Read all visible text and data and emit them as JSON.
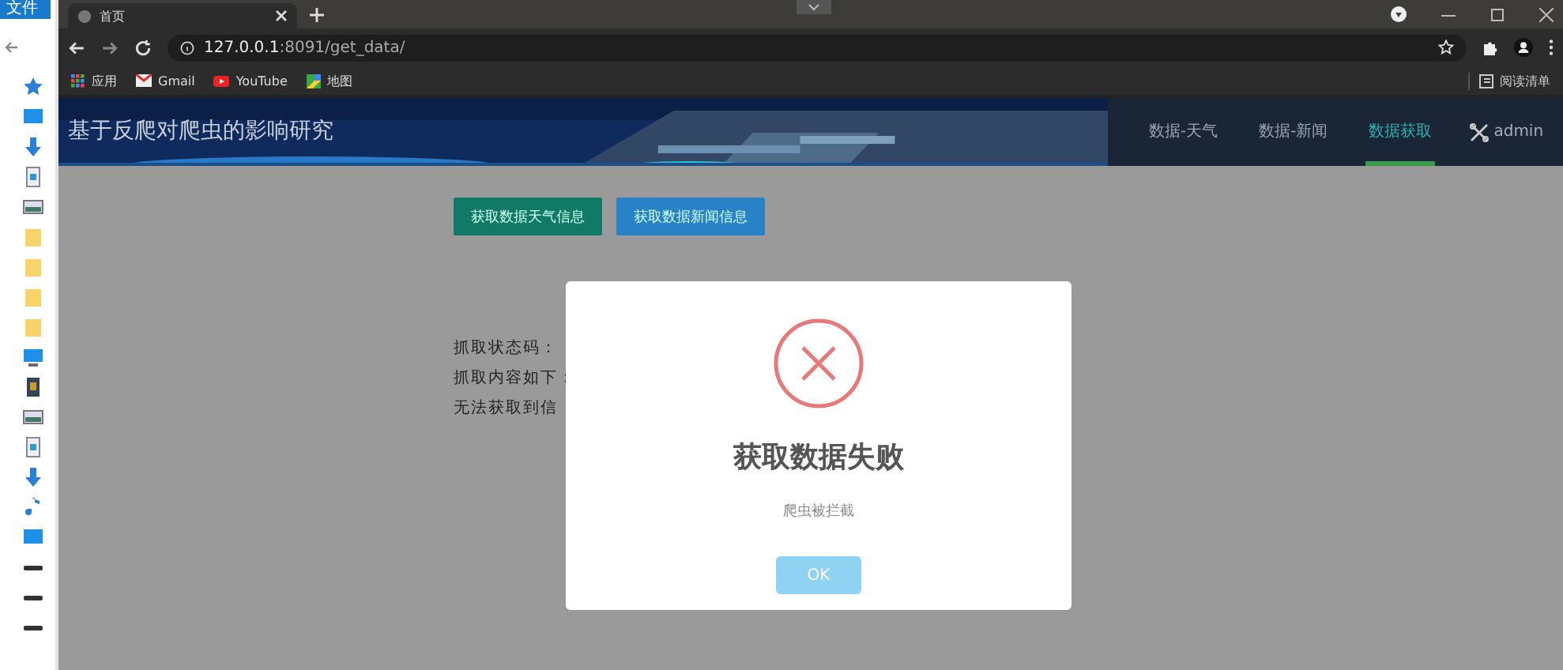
{
  "explorer": {
    "menu_label": "文件"
  },
  "browser": {
    "tab": {
      "title": "首页"
    },
    "address": {
      "host": "127.0.0.1",
      "path": ":8091/get_data/"
    },
    "bookmarks": [
      {
        "label": "应用",
        "kind": "apps"
      },
      {
        "label": "Gmail",
        "kind": "gmail"
      },
      {
        "label": "YouTube",
        "kind": "youtube"
      },
      {
        "label": "地图",
        "kind": "maps"
      }
    ],
    "reading_list": "阅读清单"
  },
  "site": {
    "title": "基于反爬对爬虫的影响研究",
    "nav": [
      {
        "label": "数据-天气",
        "selected": false
      },
      {
        "label": "数据-新闻",
        "selected": false
      },
      {
        "label": "数据获取",
        "selected": true
      }
    ],
    "user": "admin"
  },
  "actions": [
    {
      "label": "获取数据天气信息",
      "kind": "green"
    },
    {
      "label": "获取数据新闻信息",
      "kind": "blue"
    }
  ],
  "result_lines": [
    "抓取状态码：",
    "抓取内容如下：",
    "无法获取到信"
  ],
  "dialog": {
    "title": "获取数据失败",
    "message": "爬虫被拦截",
    "button": "OK"
  }
}
